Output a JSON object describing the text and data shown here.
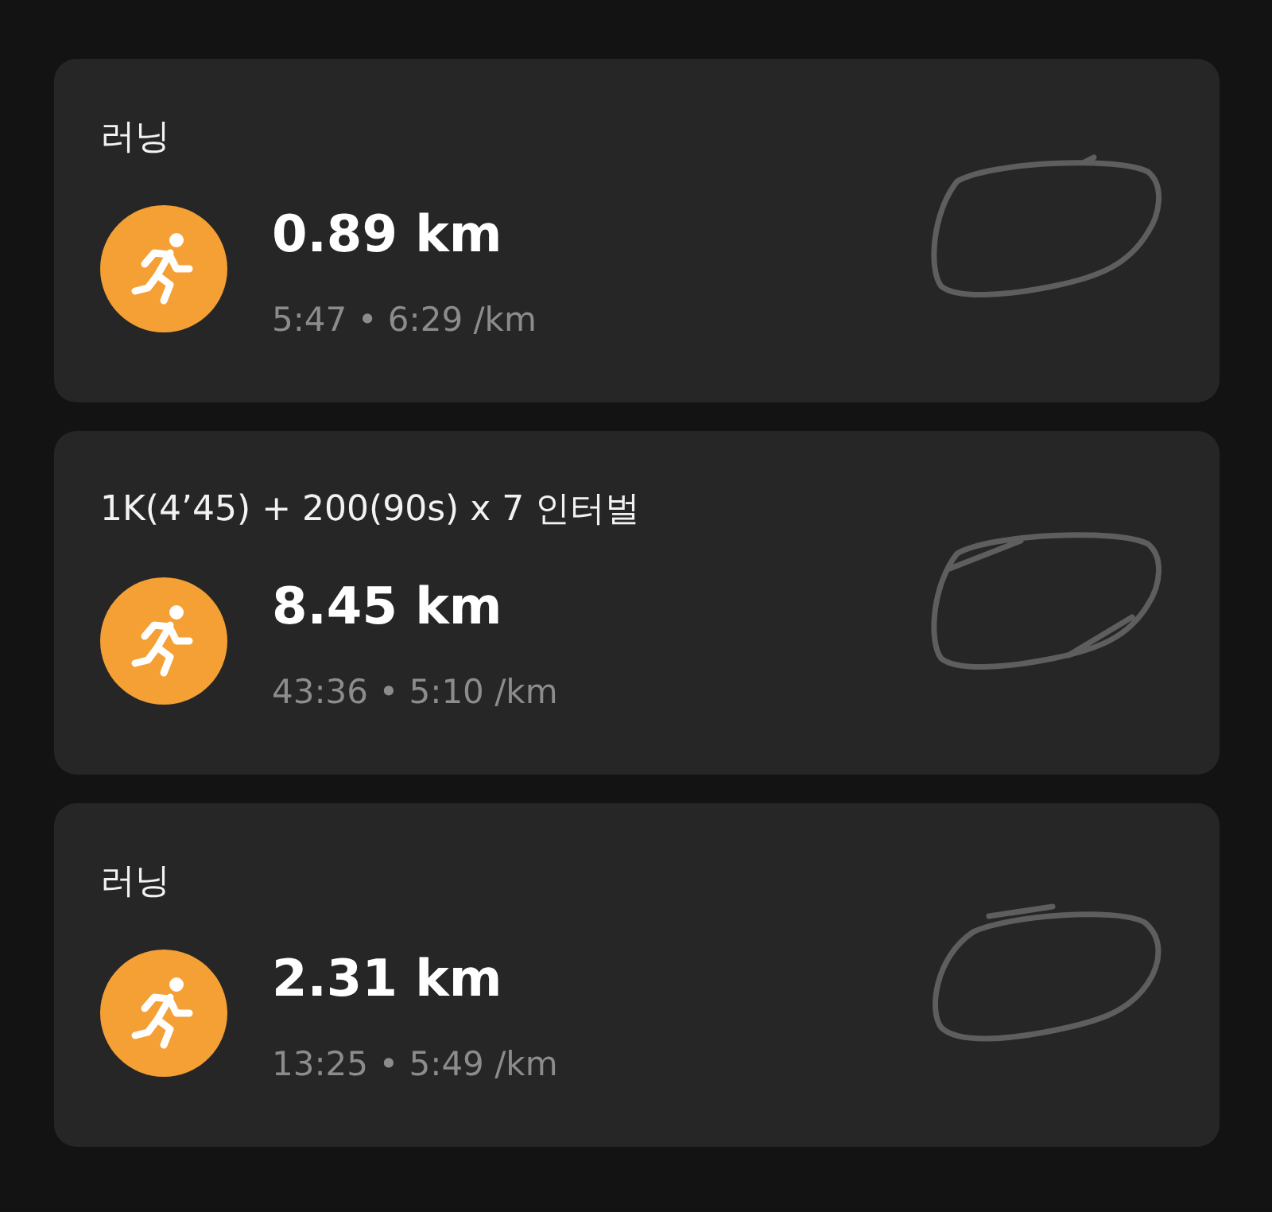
{
  "workouts": [
    {
      "title": "러닝",
      "distance": "0.89 km",
      "stats": "5:47 • 6:29 /km"
    },
    {
      "title": "1K(4’45) + 200(90s) x 7 인터벌",
      "distance": "8.45 km",
      "stats": "43:36 • 5:10 /km"
    },
    {
      "title": "러닝",
      "distance": "2.31 km",
      "stats": "13:25 • 5:49 /km"
    }
  ]
}
